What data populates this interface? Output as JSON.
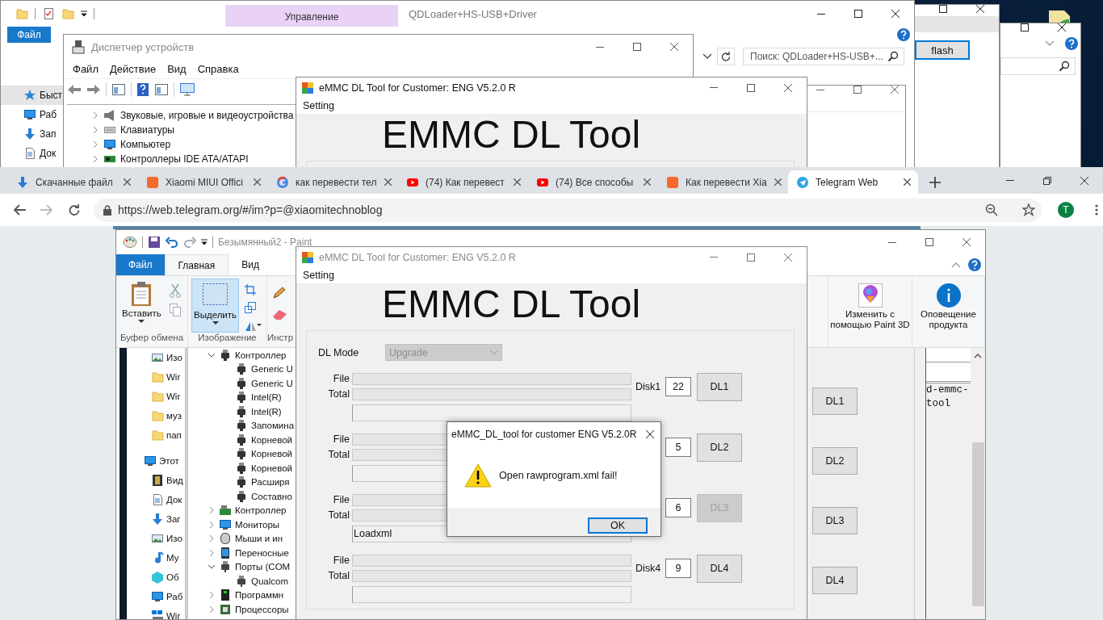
{
  "back_window": {
    "button": "flash"
  },
  "explorer": {
    "context_tab": "Управление",
    "title": "QDLoader+HS-USB+Driver",
    "file_tab": "Файл",
    "search": {
      "placeholder": "Поиск: QDLoader+HS-USB+..."
    },
    "nav": [
      {
        "label": "Быст",
        "kind": "star",
        "selected": true
      },
      {
        "label": "Раб",
        "kind": "desktop",
        "selected": false
      },
      {
        "label": "Зап",
        "kind": "download",
        "selected": false
      },
      {
        "label": "Док",
        "kind": "document",
        "selected": false
      }
    ]
  },
  "device_manager": {
    "title": "Диспетчер устройств",
    "menu": [
      "Файл",
      "Действие",
      "Вид",
      "Справка"
    ],
    "tree": [
      {
        "label": "Звуковые, игровые и видеоустройства",
        "kind": "sound",
        "expanded": false
      },
      {
        "label": "Клавиатуры",
        "kind": "keyboard",
        "expanded": false
      },
      {
        "label": "Компьютер",
        "kind": "monitor",
        "expanded": false
      },
      {
        "label": "Контроллеры IDE ATA/ATAPI",
        "kind": "card",
        "expanded": false
      }
    ]
  },
  "emmc_back": {
    "title": "eMMC DL Tool for Customer: ENG V5.2.0 R",
    "menu": "Setting",
    "heading": "EMMC DL Tool"
  },
  "browser": {
    "tabs": [
      {
        "title": "Скачанные файл",
        "kind": "download",
        "selected": false
      },
      {
        "title": "Xiaomi MIUI Offici",
        "kind": "miui",
        "selected": false
      },
      {
        "title": "как перевести тел",
        "kind": "google",
        "selected": false
      },
      {
        "title": "(74) Как перевест",
        "kind": "youtube",
        "selected": false
      },
      {
        "title": "(74) Все способы",
        "kind": "youtube",
        "selected": false
      },
      {
        "title": "Как перевести Xia",
        "kind": "miui",
        "selected": false
      },
      {
        "title": "Telegram Web",
        "kind": "telegram",
        "selected": true
      }
    ],
    "url": "https://web.telegram.org/#/im?p=@xiaomitechnoblog",
    "avatar": "T"
  },
  "paint": {
    "title": "Безымянный2 - Paint",
    "tabs": [
      {
        "label": "Файл",
        "kind": "file",
        "selected": false
      },
      {
        "label": "Главная",
        "kind": "tab",
        "selected": true
      },
      {
        "label": "Вид",
        "kind": "tab",
        "selected": false
      }
    ],
    "paste": "Вставить",
    "select": "Выделить",
    "groups": [
      "Буфер обмена",
      "Изображение",
      "Инстр"
    ],
    "paint3d": "Изменить с помощью Paint 3D",
    "notice": "Оповещение продукта",
    "canvas": {
      "nav": [
        {
          "label": "Изо",
          "kind": "image"
        },
        {
          "label": "Wir",
          "kind": "folder"
        },
        {
          "label": "Wir",
          "kind": "folder"
        },
        {
          "label": "муз",
          "kind": "folder"
        },
        {
          "label": "пап",
          "kind": "folder"
        },
        {
          "label": "Этот",
          "kind": "pc",
          "children": [
            {
              "label": "Вид",
              "kind": "video"
            },
            {
              "label": "Док",
              "kind": "document"
            },
            {
              "label": "Заг",
              "kind": "download"
            },
            {
              "label": "Изо",
              "kind": "image"
            },
            {
              "label": "Му",
              "kind": "music"
            },
            {
              "label": "Об",
              "kind": "cube"
            },
            {
              "label": "Раб",
              "kind": "desktop"
            },
            {
              "label": "Wir",
              "kind": "drive"
            }
          ]
        }
      ],
      "tree": [
        {
          "label": "Контроллер",
          "kind": "usb",
          "expanded": true,
          "children": [
            {
              "label": "Generic U"
            },
            {
              "label": "Generic U"
            },
            {
              "label": "Intel(R)"
            },
            {
              "label": "Intel(R)"
            },
            {
              "label": "Запомина"
            },
            {
              "label": "Корневой"
            },
            {
              "label": "Корневой"
            },
            {
              "label": "Корневой"
            },
            {
              "label": "Расширя"
            },
            {
              "label": "Составно"
            }
          ]
        },
        {
          "label": "Контроллер",
          "kind": "network",
          "expanded": false
        },
        {
          "label": "Мониторы",
          "kind": "monitor",
          "expanded": false
        },
        {
          "label": "Мыши и ин",
          "kind": "mouse",
          "expanded": false
        },
        {
          "label": "Переносные",
          "kind": "portable",
          "expanded": false
        },
        {
          "label": "Порты (COM",
          "kind": "port",
          "expanded": true,
          "children": [
            {
              "label": "Qualcom"
            }
          ]
        },
        {
          "label": "Программн",
          "kind": "program",
          "expanded": false
        },
        {
          "label": "Процессоры",
          "kind": "cpu",
          "expanded": false
        }
      ],
      "buttons": [
        "DL1",
        "DL2",
        "DL3",
        "DL4"
      ],
      "log": [
        "d-emmc-",
        "tool"
      ]
    }
  },
  "emmc": {
    "title": "eMMC DL Tool for Customer: ENG V5.2.0 R",
    "menu": "Setting",
    "heading": "EMMC DL Tool",
    "dl_mode": {
      "label": "DL Mode",
      "value": "Upgrade",
      "disabled": true
    },
    "rows": [
      {
        "file_label": "File",
        "total_label": "Total",
        "file": {
          "level": 0
        },
        "total": {
          "level": 0
        },
        "disk": "Disk1",
        "number": "22",
        "button": "DL1",
        "disabled": false
      },
      {
        "file_label": "File",
        "total_label": "Total",
        "file": {
          "level": 0
        },
        "total": {
          "level": 0
        },
        "number": "5",
        "button": "DL2",
        "disabled": false
      },
      {
        "file_label": "File",
        "total_label": "Total",
        "file": {
          "level": 0
        },
        "total": {
          "level": 0
        },
        "log": "Loadxml",
        "number": "6",
        "button": "DL3",
        "disabled": true
      },
      {
        "file_label": "File",
        "total_label": "Total",
        "file": {
          "level": 0
        },
        "total": {
          "level": 0
        },
        "disk": "Disk4",
        "number": "9",
        "button": "DL4",
        "disabled": false
      }
    ]
  },
  "dialog": {
    "title": "eMMC_DL_tool for customer ENG V5.2.0R",
    "message": "Open rawprogram.xml fail!",
    "button": "OK"
  }
}
